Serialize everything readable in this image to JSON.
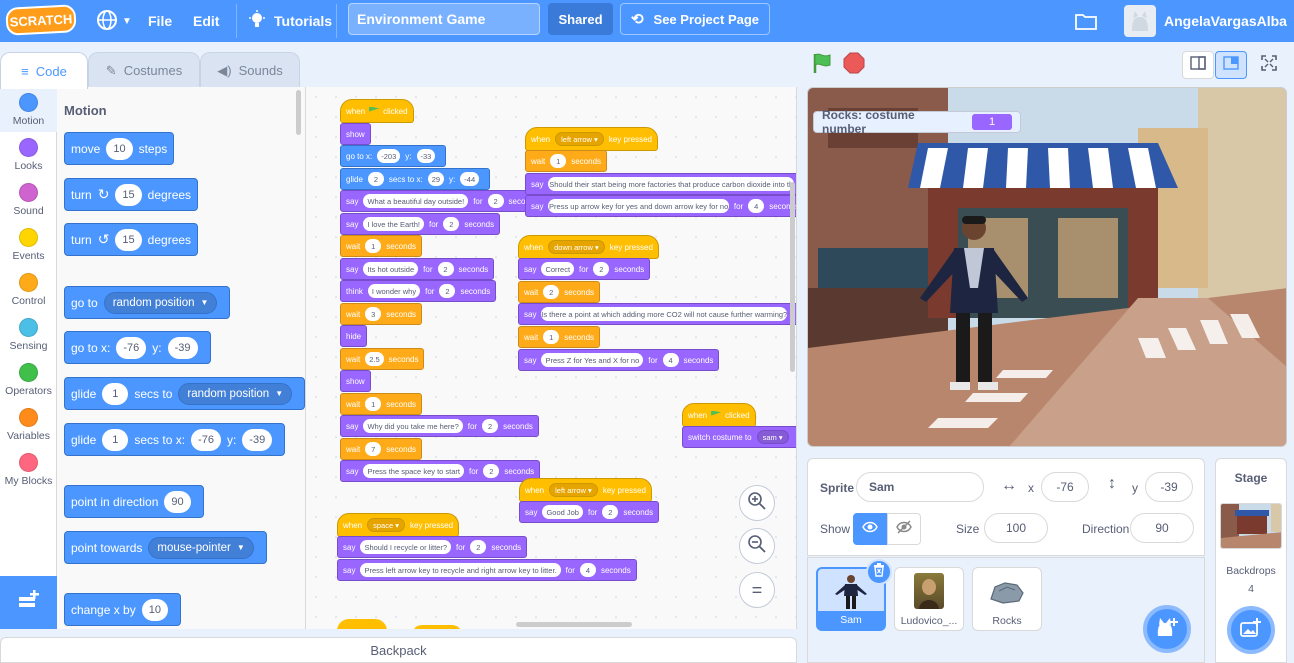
{
  "menubar": {
    "logo": "SCRATCH",
    "file": "File",
    "edit": "Edit",
    "tutorials": "Tutorials",
    "project_title": "Environment Game",
    "shared": "Shared",
    "see_project_page": "See Project Page",
    "username": "AngelaVargasAlba"
  },
  "tabs": {
    "code": "Code",
    "costumes": "Costumes",
    "sounds": "Sounds"
  },
  "categories": [
    {
      "label": "Motion",
      "color": "#4c97ff"
    },
    {
      "label": "Looks",
      "color": "#9966ff"
    },
    {
      "label": "Sound",
      "color": "#cf63cf"
    },
    {
      "label": "Events",
      "color": "#ffd500"
    },
    {
      "label": "Control",
      "color": "#ffab19"
    },
    {
      "label": "Sensing",
      "color": "#4cbfe6"
    },
    {
      "label": "Operators",
      "color": "#40bf4a"
    },
    {
      "label": "Variables",
      "color": "#ff8c1a"
    },
    {
      "label": "My Blocks",
      "color": "#ff6680"
    }
  ],
  "palette": {
    "title": "Motion",
    "move": {
      "a": "move",
      "v": "10",
      "b": "steps"
    },
    "turn_right": {
      "a": "turn",
      "v": "15",
      "b": "degrees"
    },
    "turn_left": {
      "a": "turn",
      "v": "15",
      "b": "degrees"
    },
    "goto": {
      "a": "go to",
      "d": "random position"
    },
    "gotoxy": {
      "a": "go to x:",
      "x": "-76",
      "b": "y:",
      "y": "-39"
    },
    "glide_to": {
      "a": "glide",
      "v": "1",
      "b": "secs to",
      "d": "random position"
    },
    "glide_xy": {
      "a": "glide",
      "v": "1",
      "b": "secs to x:",
      "x": "-76",
      "c": "y:",
      "y": "-39"
    },
    "point_dir": {
      "a": "point in direction",
      "v": "90"
    },
    "point_towards": {
      "a": "point towards",
      "d": "mouse-pointer"
    },
    "change_x": {
      "a": "change x by",
      "v": "10"
    }
  },
  "script1": {
    "when_flag": {
      "a": "when",
      "b": "clicked"
    },
    "show1": "show",
    "goto": {
      "a": "go to x:",
      "x": "-203",
      "b": "y:",
      "y": "-33"
    },
    "glide": {
      "a": "glide",
      "v": "2",
      "b": "secs to x:",
      "x": "29",
      "c": "y:",
      "y": "-44"
    },
    "say1": {
      "a": "say",
      "t": "What a beautiful day outside!",
      "b": "for",
      "n": "2",
      "c": "seconds"
    },
    "say2": {
      "a": "say",
      "t": "I love the Earth!",
      "b": "for",
      "n": "2",
      "c": "seconds"
    },
    "wait1": {
      "a": "wait",
      "n": "1",
      "b": "seconds"
    },
    "say3": {
      "a": "say",
      "t": "Its hot outside",
      "b": "for",
      "n": "2",
      "c": "seconds"
    },
    "think": {
      "a": "think",
      "t": "I wonder why",
      "b": "for",
      "n": "2",
      "c": "seconds"
    },
    "wait2": {
      "a": "wait",
      "n": "3",
      "b": "seconds"
    },
    "hide": "hide",
    "wait3": {
      "a": "wait",
      "n": "2.5",
      "b": "seconds"
    },
    "show2": "show",
    "wait4": {
      "a": "wait",
      "n": "1",
      "b": "seconds"
    },
    "say4": {
      "a": "say",
      "t": "Why did you take me here?",
      "b": "for",
      "n": "2",
      "c": "seconds"
    },
    "wait5": {
      "a": "wait",
      "n": "7",
      "b": "seconds"
    },
    "say5": {
      "a": "say",
      "t": "Press the space key to start",
      "b": "for",
      "n": "2",
      "c": "seconds"
    }
  },
  "script2": {
    "hat": {
      "a": "when",
      "d": "left arrow",
      "b": "key pressed"
    },
    "wait": {
      "a": "wait",
      "n": "1",
      "b": "seconds"
    },
    "say1": {
      "a": "say",
      "t": "Should their start being more factories that produce carbon dioxide into th"
    },
    "say2": {
      "a": "say",
      "t": "Press up arrow key for yes and down arrow key for no",
      "b": "for",
      "n": "4",
      "c": "seconds"
    }
  },
  "script3": {
    "hat": {
      "a": "when",
      "d": "down arrow",
      "b": "key pressed"
    },
    "say1": {
      "a": "say",
      "t": "Correct",
      "b": "for",
      "n": "2",
      "c": "seconds"
    },
    "wait1": {
      "a": "wait",
      "n": "2",
      "b": "seconds"
    },
    "say2": {
      "a": "say",
      "t": "Is there a point at which adding more CO2 will not cause further warming?"
    },
    "wait2": {
      "a": "wait",
      "n": "1",
      "b": "seconds"
    },
    "say3": {
      "a": "say",
      "t": "Press Z for Yes and X for no",
      "b": "for",
      "n": "4",
      "c": "seconds"
    }
  },
  "script4": {
    "hat": {
      "a": "when",
      "b": "clicked"
    },
    "switch": {
      "a": "switch costume to",
      "d": "sam"
    }
  },
  "script5": {
    "hat": {
      "a": "when",
      "d": "left arrow",
      "b": "key pressed"
    },
    "say": {
      "a": "say",
      "t": "Good Job",
      "b": "for",
      "n": "2",
      "c": "seconds"
    }
  },
  "script6": {
    "hat": {
      "a": "when",
      "d": "space",
      "b": "key pressed"
    },
    "say1": {
      "a": "say",
      "t": "Should I recycle or litter?",
      "b": "for",
      "n": "2",
      "c": "seconds"
    },
    "say2": {
      "a": "say",
      "t": "Press left arrow key to recycle and right arrow key to litter.",
      "b": "for",
      "n": "4",
      "c": "seconds"
    }
  },
  "backpack": "Backpack",
  "monitor": {
    "label": "Rocks: costume number",
    "value": "1"
  },
  "sprite_info": {
    "sprite_label": "Sprite",
    "sprite_name": "Sam",
    "x_label": "x",
    "x": "-76",
    "y_label": "y",
    "y": "-39",
    "show_label": "Show",
    "size_label": "Size",
    "size": "100",
    "direction_label": "Direction",
    "direction": "90"
  },
  "sprites": [
    {
      "name": "Sam"
    },
    {
      "name": "Ludovico_..."
    },
    {
      "name": "Rocks"
    }
  ],
  "stage_pane": {
    "title": "Stage",
    "backdrops_label": "Backdrops",
    "backdrops_count": "4"
  }
}
